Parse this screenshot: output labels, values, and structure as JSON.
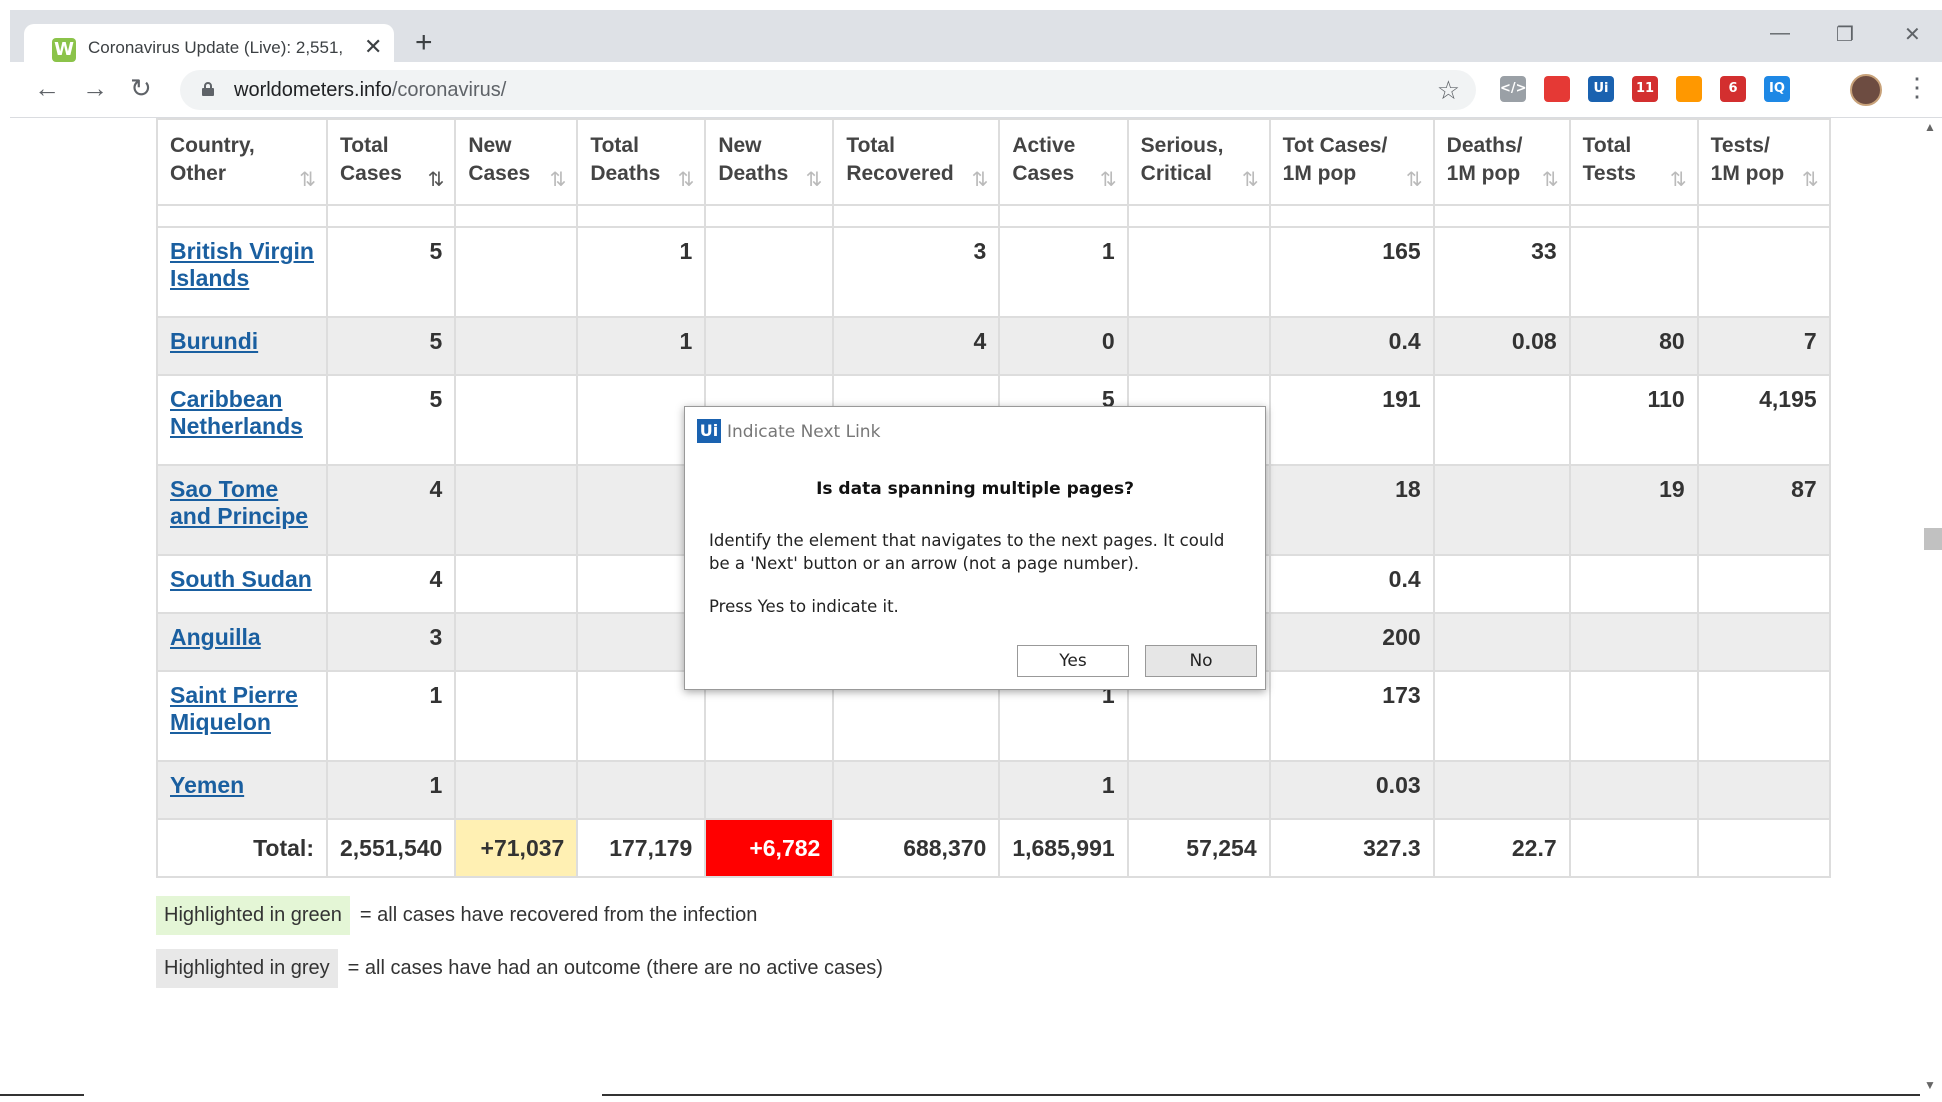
{
  "browser": {
    "tab_title": "Coronavirus Update (Live): 2,551,",
    "tab_favicon": "W",
    "close_glyph": "✕",
    "new_tab_glyph": "+",
    "url_host": "worldometers.info",
    "url_path": "/coronavirus/",
    "extensions": [
      {
        "label": "</>",
        "color": "#9aa0a6"
      },
      {
        "label": "",
        "color": "#e53935"
      },
      {
        "label": "Ui",
        "color": "#1a62b0"
      },
      {
        "label": "11",
        "color": "#d32f2f"
      },
      {
        "label": "",
        "color": "#ff9800"
      },
      {
        "label": "6",
        "color": "#d32f2f"
      },
      {
        "label": "IQ",
        "color": "#1e88e5"
      }
    ]
  },
  "table": {
    "headers": [
      {
        "line1": "Country,",
        "line2": "Other"
      },
      {
        "line1": "Total",
        "line2": "Cases"
      },
      {
        "line1": "New",
        "line2": "Cases"
      },
      {
        "line1": "Total",
        "line2": "Deaths"
      },
      {
        "line1": "New",
        "line2": "Deaths"
      },
      {
        "line1": "Total",
        "line2": "Recovered"
      },
      {
        "line1": "Active",
        "line2": "Cases"
      },
      {
        "line1": "Serious,",
        "line2": "Critical"
      },
      {
        "line1": "Tot Cases/",
        "line2": "1M pop"
      },
      {
        "line1": "Deaths/",
        "line2": "1M pop"
      },
      {
        "line1": "Total",
        "line2": "Tests"
      },
      {
        "line1": "Tests/",
        "line2": "1M pop"
      }
    ],
    "rows": [
      {
        "country": "British Virgin Islands",
        "cells": [
          "5",
          "",
          "1",
          "",
          "3",
          "1",
          "",
          "165",
          "33",
          "",
          ""
        ]
      },
      {
        "country": "Burundi",
        "cells": [
          "5",
          "",
          "1",
          "",
          "4",
          "0",
          "",
          "0.4",
          "0.08",
          "80",
          "7"
        ]
      },
      {
        "country": "Caribbean Netherlands",
        "cells": [
          "5",
          "",
          "",
          "",
          "",
          "5",
          "",
          "191",
          "",
          "110",
          "4,195"
        ]
      },
      {
        "country": "Sao Tome and Principe",
        "cells": [
          "4",
          "",
          "",
          "",
          "",
          "",
          "",
          "18",
          "",
          "19",
          "87"
        ]
      },
      {
        "country": "South Sudan",
        "cells": [
          "4",
          "",
          "",
          "",
          "",
          "",
          "",
          "0.4",
          "",
          "",
          ""
        ]
      },
      {
        "country": "Anguilla",
        "cells": [
          "3",
          "",
          "",
          "",
          "",
          "",
          "",
          "200",
          "",
          "",
          ""
        ]
      },
      {
        "country": "Saint Pierre Miquelon",
        "cells": [
          "1",
          "",
          "",
          "",
          "",
          "1",
          "",
          "173",
          "",
          "",
          ""
        ]
      },
      {
        "country": "Yemen",
        "cells": [
          "1",
          "",
          "",
          "",
          "",
          "1",
          "",
          "0.03",
          "",
          "",
          ""
        ]
      }
    ],
    "total": {
      "label": "Total:",
      "cells": [
        "2,551,540",
        "+71,037",
        "177,179",
        "+6,782",
        "688,370",
        "1,685,991",
        "57,254",
        "327.3",
        "22.7",
        "",
        ""
      ]
    }
  },
  "legend": {
    "green_chip": "Highlighted in green",
    "green_text": "= all cases have recovered from the infection",
    "grey_chip": "Highlighted in grey",
    "grey_text": "= all cases have had an outcome (there are no active cases)"
  },
  "dialog": {
    "icon": "Ui",
    "title": "Indicate Next Link",
    "question": "Is data spanning multiple pages?",
    "body": "Identify the element that navigates to the next pages. It could be a 'Next' button or an arrow (not a page number).",
    "body2": "Press Yes to indicate it.",
    "yes_label": "Yes",
    "no_label": "No"
  }
}
